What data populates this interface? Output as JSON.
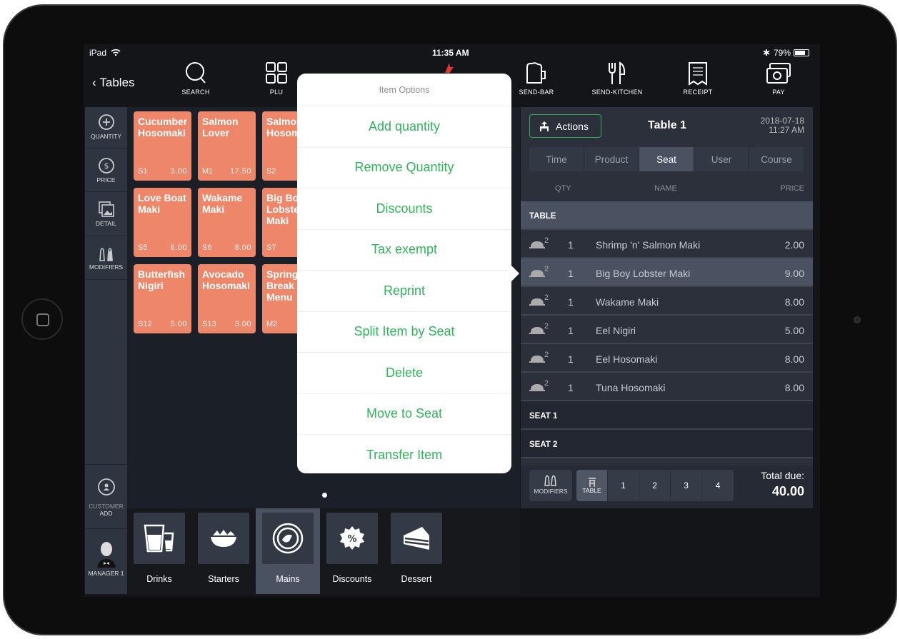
{
  "status": {
    "device": "iPad",
    "time": "11:35 AM",
    "battery": "79%"
  },
  "toolbar": {
    "back": "Tables",
    "items": [
      {
        "label": "SEARCH",
        "icon": "search-icon"
      },
      {
        "label": "PLU",
        "icon": "grid-icon"
      },
      {
        "label": "SEND-BAR",
        "icon": "beer-mug-icon"
      },
      {
        "label": "SEND-KITCHEN",
        "icon": "fork-knife-icon"
      },
      {
        "label": "RECEIPT",
        "icon": "receipt-icon"
      },
      {
        "label": "PAY",
        "icon": "cash-icon"
      }
    ]
  },
  "sidebar": {
    "items": [
      {
        "label": "QUANTITY"
      },
      {
        "label": "PRICE"
      },
      {
        "label": "DETAIL"
      },
      {
        "label": "MODIFIERS"
      }
    ],
    "customer": "CUSTOMER",
    "customer_add": "ADD",
    "user": "MANAGER 1"
  },
  "products": [
    {
      "name": "Cucumber Hosomaki",
      "code": "S1",
      "price": "3.00"
    },
    {
      "name": "Salmon Lover",
      "code": "M1",
      "price": "17.50"
    },
    {
      "name": "Salmon Hosomaki",
      "code": "S2",
      "price": ""
    },
    {
      "name": "Love Boat Maki",
      "code": "S5",
      "price": "6.00"
    },
    {
      "name": "Wakame Maki",
      "code": "S6",
      "price": "8.00"
    },
    {
      "name": "Big Boy Lobster Maki",
      "code": "S7",
      "price": ""
    },
    {
      "name": "Butterfish Nigiri",
      "code": "S12",
      "price": "5.00"
    },
    {
      "name": "Avocado Hosomaki",
      "code": "S13",
      "price": "3.00"
    },
    {
      "name": "Spring Break Menu",
      "code": "M2",
      "price": ""
    }
  ],
  "categories": [
    {
      "label": "Drinks"
    },
    {
      "label": "Starters"
    },
    {
      "label": "Mains",
      "selected": true
    },
    {
      "label": "Discounts"
    },
    {
      "label": "Dessert"
    }
  ],
  "order": {
    "actions": "Actions",
    "title": "Table 1",
    "date": "2018-07-18",
    "time": "11:27 AM",
    "tabs": [
      "Time",
      "Product",
      "Seat",
      "User",
      "Course"
    ],
    "active_tab": "Seat",
    "columns": {
      "qty": "QTY",
      "name": "NAME",
      "price": "PRICE"
    },
    "group": "TABLE",
    "items": [
      {
        "course": "2",
        "qty": "1",
        "name": "Shrimp 'n' Salmon Maki",
        "price": "2.00"
      },
      {
        "course": "2",
        "qty": "1",
        "name": "Big Boy Lobster Maki",
        "price": "9.00",
        "selected": true
      },
      {
        "course": "2",
        "qty": "1",
        "name": "Wakame Maki",
        "price": "8.00"
      },
      {
        "course": "2",
        "qty": "1",
        "name": "Eel Nigiri",
        "price": "5.00"
      },
      {
        "course": "2",
        "qty": "1",
        "name": "Eel Hosomaki",
        "price": "8.00"
      },
      {
        "course": "2",
        "qty": "1",
        "name": "Tuna Hosomaki",
        "price": "8.00"
      }
    ],
    "seats": [
      "SEAT 1",
      "SEAT 2"
    ],
    "footer": {
      "modifiers": "MODIFIERS",
      "table": "TABLE",
      "seat_buttons": [
        "1",
        "2",
        "3",
        "4"
      ],
      "total_label": "Total due:",
      "total": "40.00"
    }
  },
  "popup": {
    "title": "Item Options",
    "options": [
      "Add quantity",
      "Remove Quantity",
      "Discounts",
      "Tax exempt",
      "Reprint",
      "Split Item by Seat",
      "Delete",
      "Move to Seat",
      "Transfer Item"
    ]
  },
  "colors": {
    "accent": "#2fb45a",
    "tile": "#ee876a",
    "logo": "#e03a2f"
  }
}
